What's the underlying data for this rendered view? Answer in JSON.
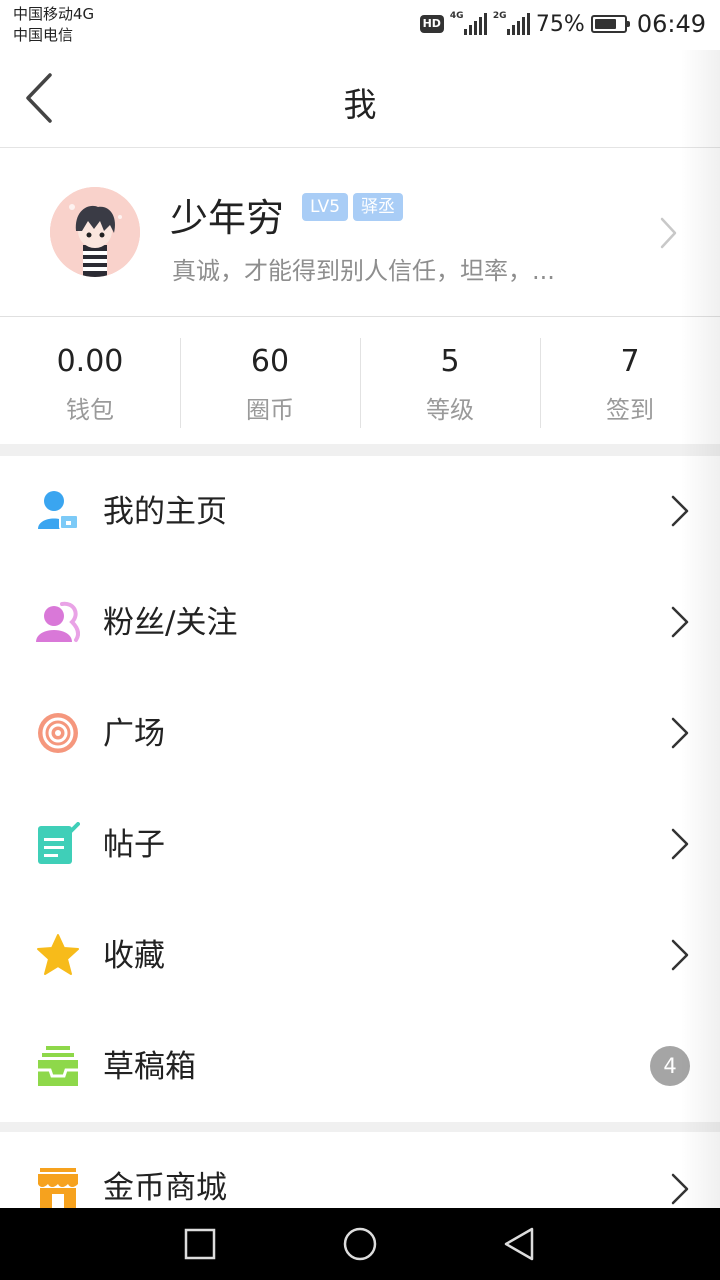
{
  "status_bar": {
    "carrier_1": "中国移动4G",
    "carrier_2": "中国电信",
    "hd_label": "HD",
    "net_1": "4G",
    "net_2": "2G",
    "battery_percent": "75%",
    "battery_level": 0.75,
    "time": "06:49"
  },
  "header": {
    "back_icon": "chevron-left-icon",
    "title": "我"
  },
  "profile": {
    "nickname": "少年穷",
    "level_badge": "LV5",
    "title_badge": "驿丞",
    "signature": "真诚，才能得到别人信任，坦率，...",
    "badge_color": "#a9cdf6"
  },
  "stats": [
    {
      "value": "0.00",
      "label": "钱包"
    },
    {
      "value": "60",
      "label": "圈币"
    },
    {
      "value": "5",
      "label": "等级"
    },
    {
      "value": "7",
      "label": "签到"
    }
  ],
  "menu": [
    {
      "label": "我的主页",
      "icon": "user-home-icon",
      "color": "#3aa5f0"
    },
    {
      "label": "粉丝/关注",
      "icon": "fans-icon",
      "color": "#d978d8"
    },
    {
      "label": "广场",
      "icon": "target-icon",
      "color": "#f5977d"
    },
    {
      "label": "帖子",
      "icon": "post-icon",
      "color": "#3fcfb8"
    },
    {
      "label": "收藏",
      "icon": "star-icon",
      "color": "#f7bb1a"
    },
    {
      "label": "草稿箱",
      "icon": "drafts-inbox-icon",
      "color": "#8ed84a",
      "badge": "4"
    }
  ],
  "menu2": [
    {
      "label": "金币商城",
      "icon": "shop-icon",
      "color": "#f6a21e"
    }
  ],
  "navbar": {
    "recent_icon": "recent-apps-icon",
    "home_icon": "home-circle-icon",
    "back_icon": "back-triangle-icon"
  }
}
